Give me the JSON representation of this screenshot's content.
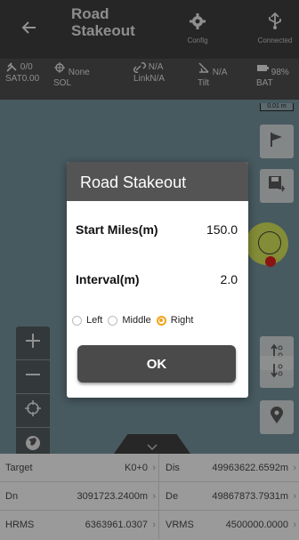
{
  "appbar": {
    "title": "Road Stakeout",
    "config_label": "Config",
    "connected_label": "Connected"
  },
  "status": {
    "sat_top": "0/0",
    "sat_bottom_label": "SAT",
    "sat_bottom_value": "0.00",
    "sol_value": "None",
    "sol_label": "SOL",
    "link_top": "N/A",
    "link_label": "Link",
    "link_value": "N/A",
    "tilt_value": "N/A",
    "tilt_label": "Tilt",
    "bat_value": "98%",
    "bat_label": "BAT"
  },
  "map": {
    "scale_label": "0.01 m"
  },
  "dialog": {
    "title": "Road Stakeout",
    "start_miles_label": "Start Miles(m)",
    "start_miles_value": "150.0",
    "interval_label": "Interval(m)",
    "interval_value": "2.0",
    "options": [
      "Left",
      "Middle",
      "Right"
    ],
    "selected": "Right",
    "ok_label": "OK"
  },
  "bottom": {
    "rows": [
      {
        "k1": "Target",
        "v1": "K0+0",
        "k2": "Dis",
        "v2": "49963622.6592m"
      },
      {
        "k1": "Dn",
        "v1": "3091723.2400m",
        "k2": "De",
        "v2": "49867873.7931m"
      },
      {
        "k1": "HRMS",
        "v1": "6363961.0307",
        "k2": "VRMS",
        "v2": "4500000.0000"
      }
    ]
  },
  "colors": {
    "appbar": "#3b3b3b",
    "map": "#6e8a94",
    "dialog_header": "#545454",
    "radio_selected": "#f2a31a",
    "target_circle": "#d9e64a",
    "target_dot": "#d52020"
  }
}
